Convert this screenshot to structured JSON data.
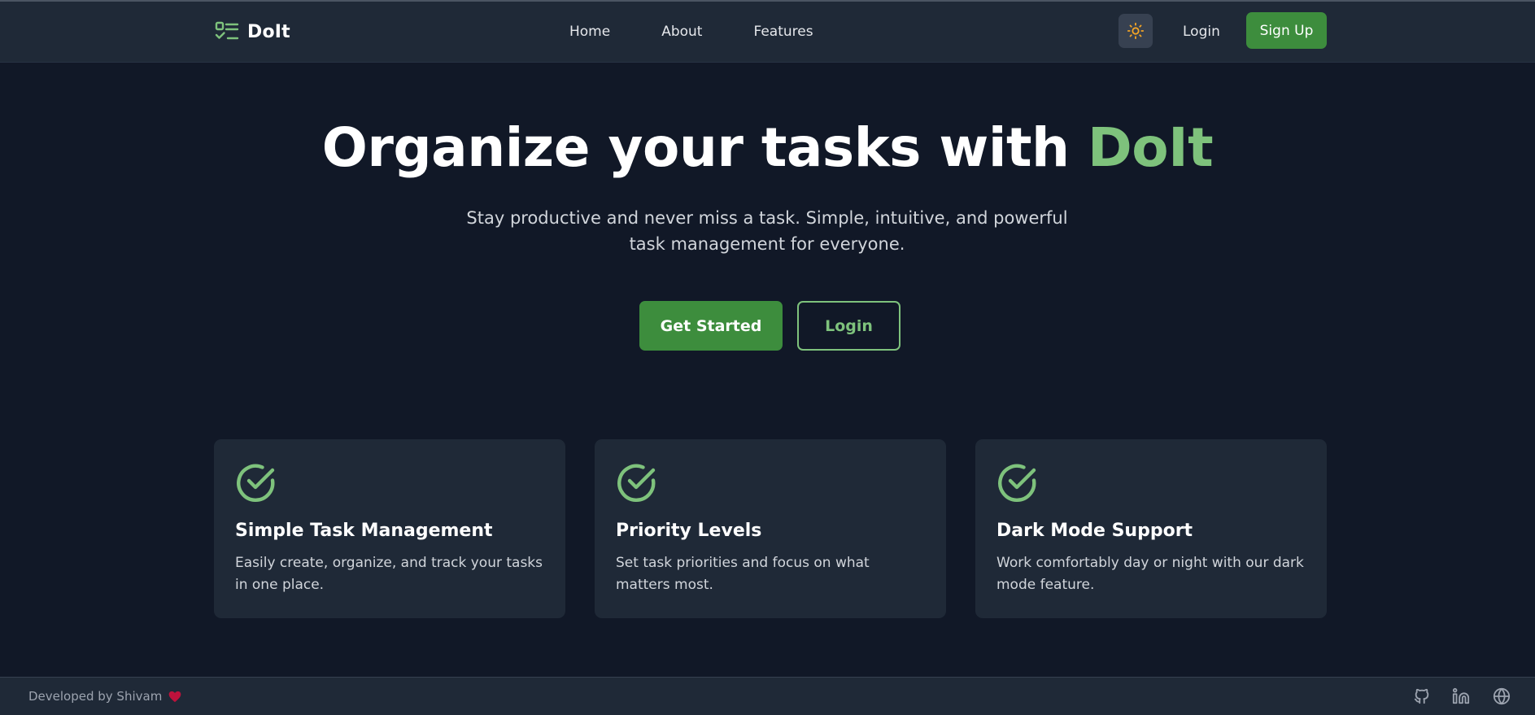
{
  "header": {
    "brand": "DoIt",
    "nav": [
      "Home",
      "About",
      "Features"
    ],
    "login_label": "Login",
    "signup_label": "Sign Up",
    "theme_icon": "sun-icon"
  },
  "hero": {
    "title_main": "Organize your tasks with ",
    "title_accent": "DoIt",
    "subtitle": "Stay productive and never miss a task. Simple, intuitive, and powerful task management for everyone.",
    "primary_label": "Get Started",
    "secondary_label": "Login"
  },
  "features": [
    {
      "title": "Simple Task Management",
      "desc": "Easily create, organize, and track your tasks in one place.",
      "icon": "check-circle-icon"
    },
    {
      "title": "Priority Levels",
      "desc": "Set task priorities and focus on what matters most.",
      "icon": "check-circle-icon"
    },
    {
      "title": "Dark Mode Support",
      "desc": "Work comfortably day or night with our dark mode feature.",
      "icon": "check-circle-icon"
    }
  ],
  "footer": {
    "credit": "Developed by Shivam",
    "icons": [
      "github-icon",
      "linkedin-icon",
      "globe-icon"
    ]
  },
  "colors": {
    "background": "#111827",
    "surface": "#1f2937",
    "accent": "#7ec27c",
    "button": "#3d8d3d",
    "heart": "#be123c"
  }
}
